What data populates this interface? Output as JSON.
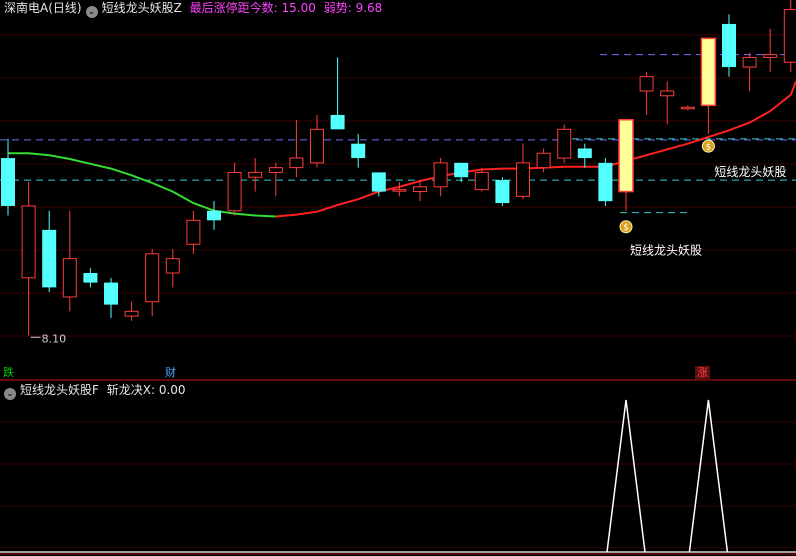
{
  "header": {
    "stock": "深南电A(日线)",
    "indicator": "短线龙头妖股Z",
    "stat1_label": "最后涨停距今数:",
    "stat1_value": "15.00",
    "stat2_label": "弱势:",
    "stat2_value": "9.68"
  },
  "sub_header": {
    "indicator": "短线龙头妖股F",
    "label": "斩龙决X:",
    "value": "0.00"
  },
  "markers": [
    {
      "text": "跌",
      "color": "#00cc00"
    },
    {
      "text": "财",
      "color": "#4aa3ff"
    },
    {
      "text": "涨",
      "color": "#ff4040"
    }
  ],
  "colors": {
    "up": "#ff3c3c",
    "down": "#54ffff",
    "limit_up": "#ffff99",
    "ma_up": "#ff2020",
    "ma_down": "#33dd33",
    "purple_dash": "#7070ff",
    "cyan_dash": "#33cccc",
    "signal": "#ffffff"
  },
  "chart_data": [
    {
      "type": "candlestick",
      "title": "短线龙头妖股Z",
      "ylim": [
        7.8,
        11.6
      ],
      "low_label": "8.10",
      "signal_label": "短线龙头妖股",
      "candles": [
        {
          "o": 9.95,
          "h": 10.15,
          "l": 9.35,
          "c": 9.45,
          "k": "down"
        },
        {
          "o": 8.7,
          "h": 9.7,
          "l": 8.1,
          "c": 9.45,
          "k": "up"
        },
        {
          "o": 9.2,
          "h": 9.4,
          "l": 8.55,
          "c": 8.6,
          "k": "down"
        },
        {
          "o": 8.5,
          "h": 9.4,
          "l": 8.35,
          "c": 8.9,
          "k": "up"
        },
        {
          "o": 8.75,
          "h": 8.8,
          "l": 8.6,
          "c": 8.65,
          "k": "down"
        },
        {
          "o": 8.65,
          "h": 8.7,
          "l": 8.28,
          "c": 8.42,
          "k": "down"
        },
        {
          "o": 8.3,
          "h": 8.45,
          "l": 8.25,
          "c": 8.35,
          "k": "up"
        },
        {
          "o": 8.45,
          "h": 9.0,
          "l": 8.3,
          "c": 8.95,
          "k": "up"
        },
        {
          "o": 8.75,
          "h": 9.0,
          "l": 8.6,
          "c": 8.9,
          "k": "up"
        },
        {
          "o": 9.05,
          "h": 9.4,
          "l": 8.95,
          "c": 9.3,
          "k": "up"
        },
        {
          "o": 9.4,
          "h": 9.5,
          "l": 9.2,
          "c": 9.3,
          "k": "down"
        },
        {
          "o": 9.4,
          "h": 9.9,
          "l": 9.35,
          "c": 9.8,
          "k": "up"
        },
        {
          "o": 9.75,
          "h": 9.95,
          "l": 9.6,
          "c": 9.8,
          "k": "up"
        },
        {
          "o": 9.8,
          "h": 9.9,
          "l": 9.55,
          "c": 9.85,
          "k": "up"
        },
        {
          "o": 9.85,
          "h": 10.35,
          "l": 9.75,
          "c": 9.95,
          "k": "up"
        },
        {
          "o": 9.9,
          "h": 10.4,
          "l": 9.85,
          "c": 10.25,
          "k": "up"
        },
        {
          "o": 10.4,
          "h": 11.0,
          "l": 10.25,
          "c": 10.25,
          "k": "down"
        },
        {
          "o": 10.1,
          "h": 10.2,
          "l": 9.85,
          "c": 9.95,
          "k": "down"
        },
        {
          "o": 9.8,
          "h": 9.8,
          "l": 9.55,
          "c": 9.6,
          "k": "down"
        },
        {
          "o": 9.62,
          "h": 9.7,
          "l": 9.55,
          "c": 9.62,
          "k": "up"
        },
        {
          "o": 9.6,
          "h": 9.7,
          "l": 9.5,
          "c": 9.65,
          "k": "up"
        },
        {
          "o": 9.65,
          "h": 9.95,
          "l": 9.55,
          "c": 9.9,
          "k": "up"
        },
        {
          "o": 9.9,
          "h": 9.9,
          "l": 9.7,
          "c": 9.75,
          "k": "down"
        },
        {
          "o": 9.62,
          "h": 9.85,
          "l": 9.6,
          "c": 9.8,
          "k": "up"
        },
        {
          "o": 9.72,
          "h": 9.75,
          "l": 9.45,
          "c": 9.48,
          "k": "down"
        },
        {
          "o": 9.55,
          "h": 10.1,
          "l": 9.52,
          "c": 9.9,
          "k": "up"
        },
        {
          "o": 9.85,
          "h": 10.05,
          "l": 9.8,
          "c": 10.0,
          "k": "up"
        },
        {
          "o": 9.95,
          "h": 10.3,
          "l": 9.9,
          "c": 10.25,
          "k": "up"
        },
        {
          "o": 10.05,
          "h": 10.1,
          "l": 9.85,
          "c": 9.95,
          "k": "down"
        },
        {
          "o": 9.9,
          "h": 9.95,
          "l": 9.45,
          "c": 9.5,
          "k": "down"
        },
        {
          "o": 9.6,
          "h": 10.35,
          "l": 9.4,
          "c": 10.35,
          "k": "limit"
        },
        {
          "o": 10.65,
          "h": 10.85,
          "l": 10.4,
          "c": 10.8,
          "k": "up"
        },
        {
          "o": 10.65,
          "h": 10.75,
          "l": 10.3,
          "c": 10.6,
          "k": "up"
        },
        {
          "o": 10.47,
          "h": 10.5,
          "l": 10.45,
          "c": 10.48,
          "k": "up"
        },
        {
          "o": 10.5,
          "h": 11.2,
          "l": 10.2,
          "c": 11.2,
          "k": "limit"
        },
        {
          "o": 11.35,
          "h": 11.45,
          "l": 10.8,
          "c": 10.9,
          "k": "down"
        },
        {
          "o": 10.9,
          "h": 11.05,
          "l": 10.65,
          "c": 11.0,
          "k": "up"
        },
        {
          "o": 11.0,
          "h": 11.3,
          "l": 10.85,
          "c": 11.03,
          "k": "up"
        },
        {
          "o": 10.95,
          "h": 11.85,
          "l": 10.85,
          "c": 11.5,
          "k": "up"
        }
      ],
      "ma": [
        10.0,
        10.0,
        9.98,
        9.94,
        9.89,
        9.84,
        9.77,
        9.69,
        9.6,
        9.48,
        9.4,
        9.37,
        9.35,
        9.34,
        9.36,
        9.39,
        9.46,
        9.52,
        9.6,
        9.65,
        9.71,
        9.76,
        9.8,
        9.83,
        9.84,
        9.84,
        9.85,
        9.86,
        9.86,
        9.86,
        9.92,
        9.98,
        10.04,
        10.1,
        10.17,
        10.24,
        10.32,
        10.44,
        10.61
      ],
      "ma_switch_index": 13,
      "ref_lines": [
        {
          "y": 10.14,
          "style": "purple"
        },
        {
          "y": 9.72,
          "style": "cyan"
        },
        {
          "y": 11.03,
          "style": "purple"
        },
        {
          "y": 10.15,
          "style": "cyan"
        },
        {
          "y": 9.38,
          "style": "cyan"
        }
      ],
      "signals": [
        30,
        34
      ]
    },
    {
      "type": "line",
      "title": "斩龙决X",
      "ylim": [
        0,
        1
      ],
      "values": [
        0,
        0,
        0,
        0,
        0,
        0,
        0,
        0,
        0,
        0,
        0,
        0,
        0,
        0,
        0,
        0,
        0,
        0,
        0,
        0,
        0,
        0,
        0,
        0,
        0,
        0,
        0,
        0,
        0,
        0,
        1,
        0,
        0,
        0,
        1,
        0,
        0,
        0,
        0
      ]
    }
  ]
}
